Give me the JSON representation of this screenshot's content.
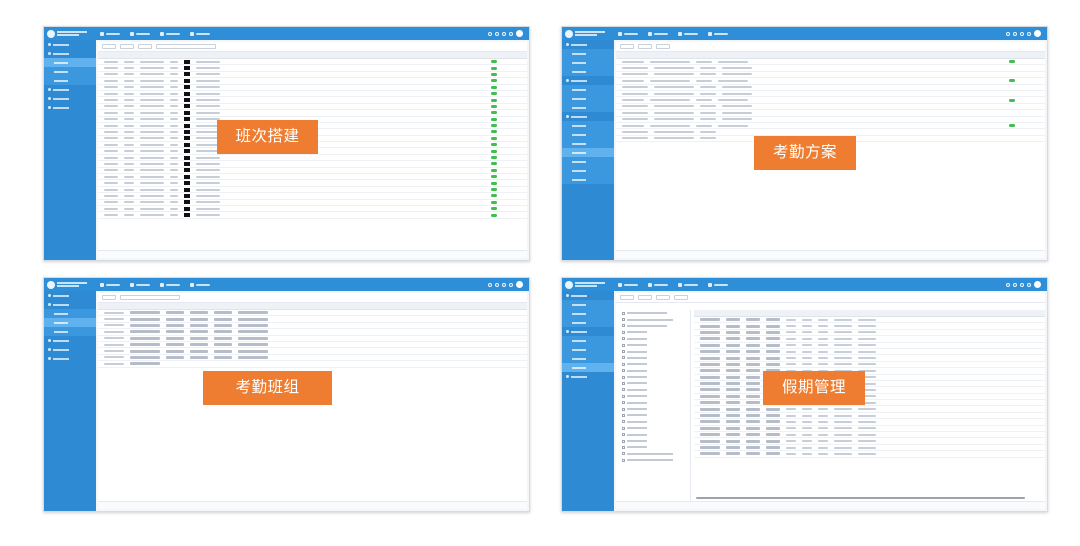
{
  "colors": {
    "accent": "#2f8ed8",
    "sidebar": "#2e8ad2",
    "badge": "#ee7d31",
    "toggle_on": "#3fbf4f"
  },
  "panels": [
    {
      "id": "p1",
      "label": "班次搭建"
    },
    {
      "id": "p2",
      "label": "考勤方案"
    },
    {
      "id": "p3",
      "label": "考勤班组"
    },
    {
      "id": "p4",
      "label": "假期管理"
    }
  ],
  "icons": [
    "logo-icon",
    "search-icon",
    "bell-icon",
    "settings-icon",
    "avatar-icon",
    "toggle-on-icon"
  ]
}
